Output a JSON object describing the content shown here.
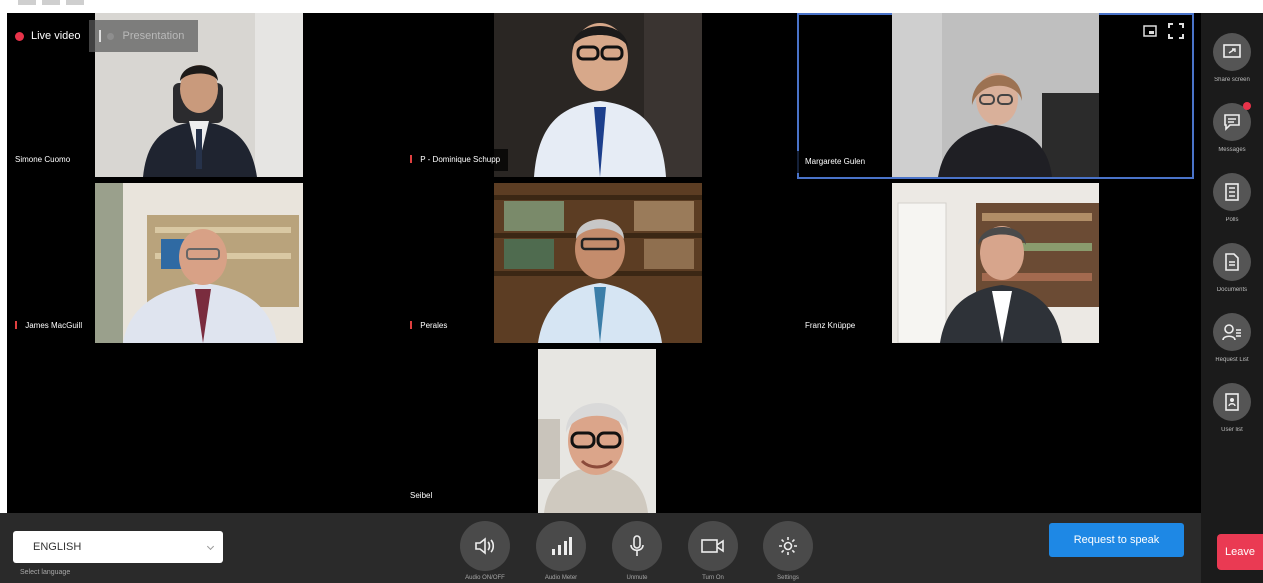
{
  "colors": {
    "accent_blue": "#1e88e5",
    "leave_red": "#ea3a53",
    "live_red": "#e8334a",
    "active_border": "#4a73c9",
    "stage_bg": "#000000",
    "control_bar_bg": "#2a2a2a"
  },
  "stage_tabs": {
    "live": "Live video",
    "presentation": "Presentation"
  },
  "participants": [
    {
      "name": "Simone Cuomo"
    },
    {
      "name": "P - Dominique Schupp"
    },
    {
      "name": "Margarete Gulen"
    },
    {
      "name": "James MacGuill"
    },
    {
      "name": "Perales"
    },
    {
      "name": "Franz Knüppe"
    },
    {
      "name": "Seibel"
    }
  ],
  "tile_tools": [
    "minimize-icon",
    "fullscreen-icon"
  ],
  "sidebar": {
    "items": [
      {
        "label": "Share screen",
        "icon": "share-screen-icon"
      },
      {
        "label": "Messages",
        "icon": "messages-icon"
      },
      {
        "label": "Polls",
        "icon": "polls-icon"
      },
      {
        "label": "Documents",
        "icon": "documents-icon"
      },
      {
        "label": "Request List",
        "icon": "request-list-icon"
      },
      {
        "label": "User list",
        "icon": "user-list-icon"
      }
    ],
    "leave": "Leave"
  },
  "language": {
    "value": "ENGLISH",
    "label": "Select language"
  },
  "controls": [
    {
      "label": "Audio ON/OFF",
      "icon": "speaker-icon"
    },
    {
      "label": "Audio Meter",
      "icon": "signal-bars-icon"
    },
    {
      "label": "Unmute",
      "icon": "microphone-icon"
    },
    {
      "label": "Turn On",
      "icon": "camera-icon"
    },
    {
      "label": "Settings",
      "icon": "gear-icon"
    }
  ],
  "request_to_speak": "Request to speak"
}
